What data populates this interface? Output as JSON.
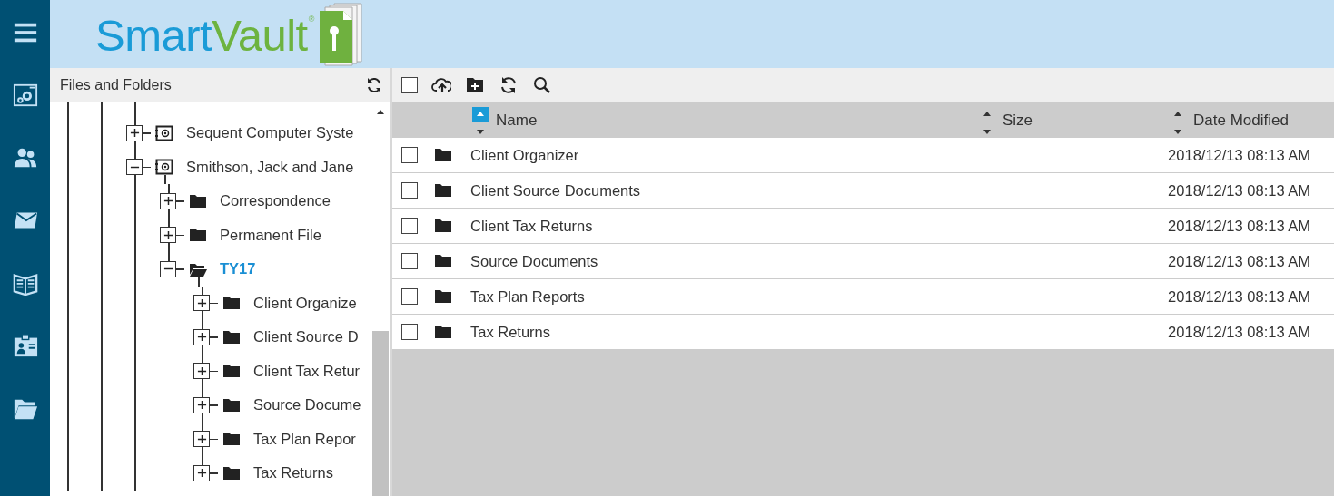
{
  "nav": [
    {
      "kind": "menu"
    },
    {
      "kind": "settings"
    },
    {
      "kind": "people"
    },
    {
      "kind": "mail"
    },
    {
      "kind": "book"
    },
    {
      "kind": "contact"
    },
    {
      "kind": "folder"
    }
  ],
  "logo": {
    "parts": [
      "Smart",
      "Vault"
    ],
    "mark": "®"
  },
  "tree_panel": {
    "title": "Files and Folders",
    "items": [
      {
        "label": "Sequent Computer Syste",
        "kind": "vault",
        "expanded": false,
        "selected": false
      },
      {
        "label": "Smithson, Jack and Jane",
        "kind": "vault",
        "expanded": true,
        "selected": false,
        "children": [
          {
            "label": "Correspondence",
            "kind": "folder",
            "expanded": false,
            "selected": false
          },
          {
            "label": "Permanent File",
            "kind": "folder",
            "expanded": false,
            "selected": false
          },
          {
            "label": "TY17",
            "kind": "folder",
            "expanded": true,
            "selected": true,
            "children": [
              {
                "label": "Client Organize",
                "kind": "folder",
                "expanded": false,
                "selected": false
              },
              {
                "label": "Client Source D",
                "kind": "folder",
                "expanded": false,
                "selected": false
              },
              {
                "label": "Client Tax Retur",
                "kind": "folder",
                "expanded": false,
                "selected": false
              },
              {
                "label": "Source Docume",
                "kind": "folder",
                "expanded": false,
                "selected": false
              },
              {
                "label": "Tax Plan Repor",
                "kind": "folder",
                "expanded": false,
                "selected": false
              },
              {
                "label": "Tax Returns",
                "kind": "folder",
                "expanded": false,
                "selected": false
              }
            ]
          }
        ]
      }
    ]
  },
  "toolbar": {
    "select_all_checked": false,
    "tools": [
      {
        "kind": "upload"
      },
      {
        "kind": "new-folder"
      },
      {
        "kind": "refresh"
      },
      {
        "kind": "search"
      }
    ]
  },
  "table": {
    "columns": [
      {
        "label": "Name",
        "sorted": true
      },
      {
        "label": "Size",
        "sorted": false
      },
      {
        "label": "Date Modified",
        "sorted": false
      }
    ],
    "rows": [
      {
        "name": "Client Organizer",
        "size": "",
        "date": "2018/12/13 08:13 AM",
        "checked": false
      },
      {
        "name": "Client Source Documents",
        "date": "2018/12/13 08:13 AM",
        "checked": false
      },
      {
        "name": "Client Tax Returns",
        "date": "2018/12/13 08:13 AM",
        "checked": false
      },
      {
        "name": "Source Documents",
        "date": "2018/12/13 08:13 AM",
        "checked": false
      },
      {
        "name": "Tax Plan Reports",
        "date": "2018/12/13 08:13 AM",
        "checked": false
      },
      {
        "name": "Tax Returns",
        "date": "2018/12/13 08:13 AM",
        "checked": false
      }
    ]
  }
}
